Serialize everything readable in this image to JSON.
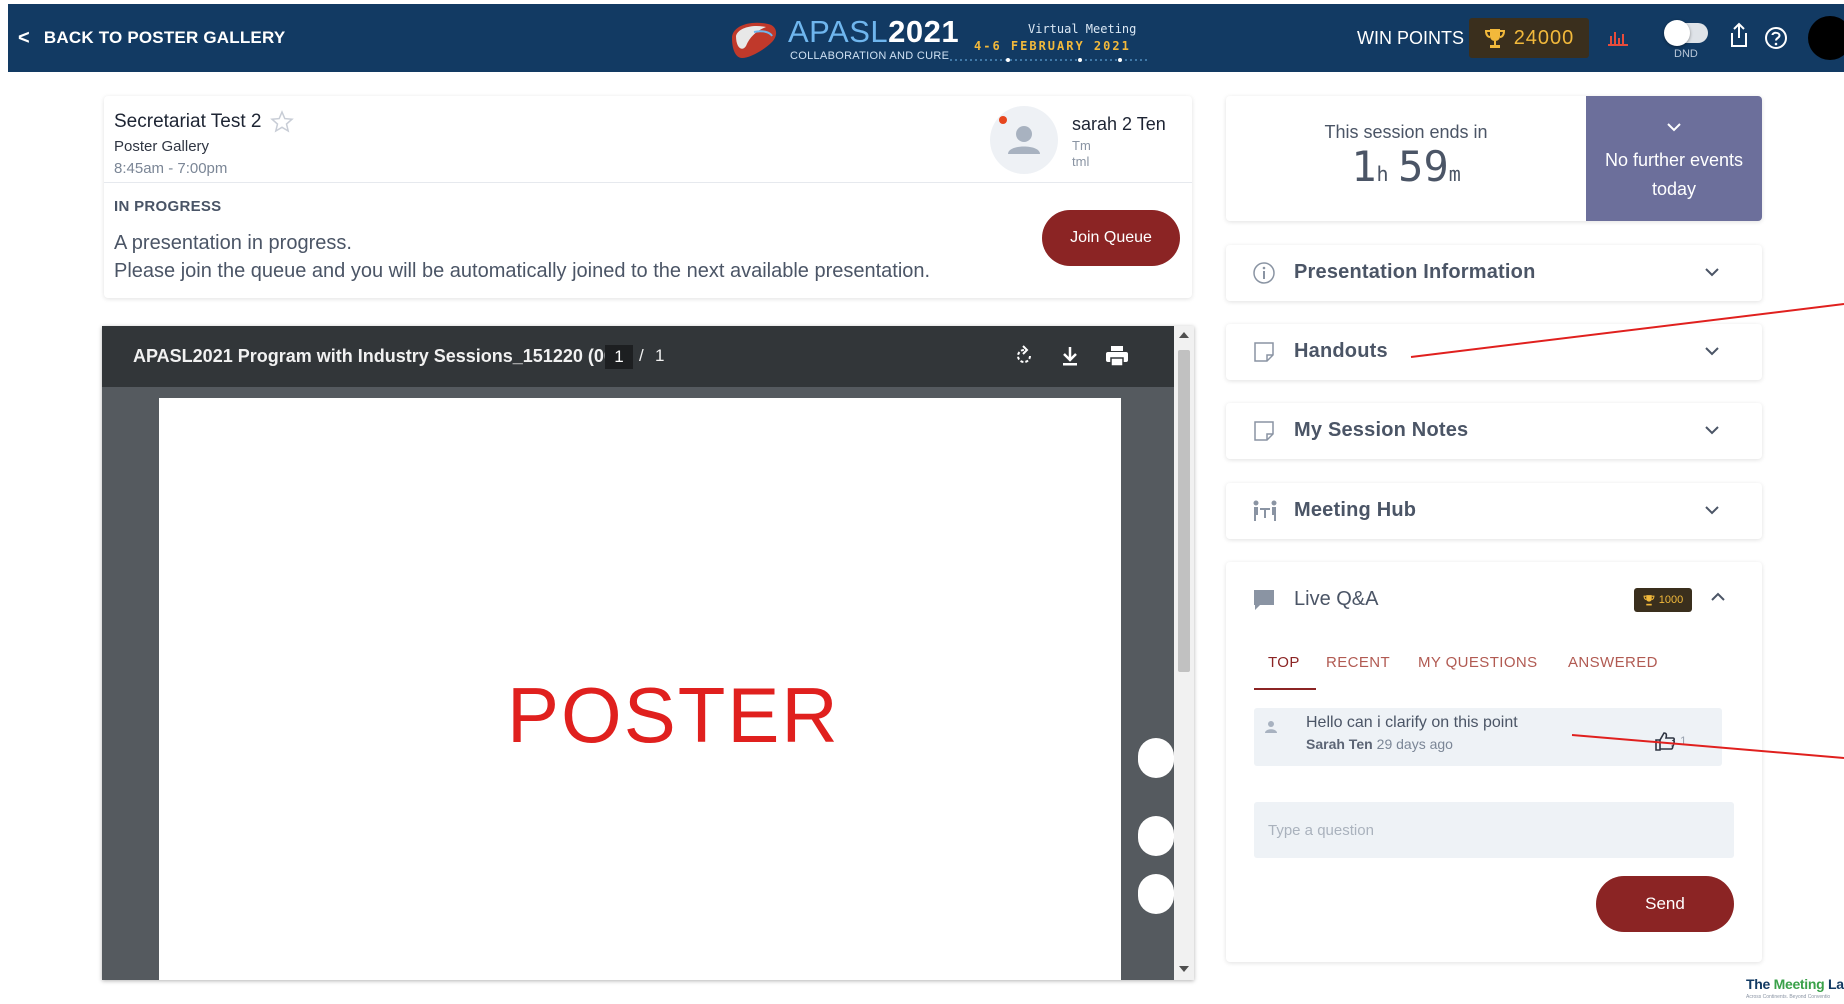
{
  "header": {
    "back_label": "BACK TO POSTER GALLERY",
    "logo": {
      "brand": "APASL",
      "year": "2021",
      "tagline": "COLLABORATION AND CURE",
      "virtual": "Virtual Meeting",
      "dates": "4-6 FEBRUARY 2021"
    },
    "win_points_label": "WIN POINTS",
    "points": "24000",
    "dnd_label": "DND",
    "colors": {
      "bar": "#123a63",
      "points_text": "#f2b93b"
    }
  },
  "session": {
    "title": "Secretariat Test 2",
    "location": "Poster Gallery",
    "time": "8:45am - 7:00pm",
    "presenter": {
      "name": "sarah 2 Ten",
      "line1": "Tm",
      "line2": "tml"
    },
    "status": "IN PROGRESS",
    "message_line1": "A presentation in progress.",
    "message_line2": "Please join the queue and you will be automatically joined to the next available presentation.",
    "join_button": "Join Queue"
  },
  "viewer": {
    "file_title": "APASL2021 Program with Industry Sessions_151220 (00...",
    "current_page": "1",
    "separator": "/",
    "total_pages": "1",
    "poster_text": "POSTER"
  },
  "timer": {
    "label": "This session ends in",
    "hours": "1",
    "hours_unit": "h",
    "minutes": "59",
    "minutes_unit": "m",
    "no_events": "No further events today"
  },
  "accordions": [
    {
      "label": "Presentation Information",
      "icon": "info-icon"
    },
    {
      "label": "Handouts",
      "icon": "note-icon"
    },
    {
      "label": "My Session Notes",
      "icon": "note-icon"
    },
    {
      "label": "Meeting Hub",
      "icon": "meeting-icon"
    }
  ],
  "qa": {
    "title": "Live Q&A",
    "badge_points": "1000",
    "tabs": [
      "TOP",
      "RECENT",
      "MY QUESTIONS",
      "ANSWERED"
    ],
    "active_tab": "TOP",
    "questions": [
      {
        "text": "Hello can i clarify on this point",
        "author": "Sarah Ten",
        "ago": "29 days ago",
        "likes": "1"
      }
    ],
    "input_placeholder": "Type a question",
    "send_button": "Send"
  },
  "footer": {
    "brand_a": "The ",
    "brand_b": "Meeting",
    "brand_c": " La",
    "tagline": "Across Continents. Beyond Conventio"
  },
  "colors": {
    "accent": "#8b2424",
    "annotation": "#e0201e",
    "panel": "#6c6f9b"
  }
}
